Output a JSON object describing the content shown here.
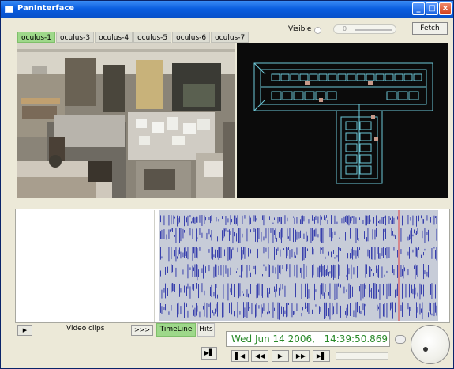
{
  "window": {
    "title": "PanInterface",
    "min": "_",
    "max": "□",
    "close": "x"
  },
  "camera_tabs": [
    "oculus-1",
    "oculus-3",
    "oculus-4",
    "oculus-5",
    "oculus-6",
    "oculus-7"
  ],
  "active_tab": "oculus-1",
  "visible": {
    "label": "Visible",
    "slider_value": "0"
  },
  "fetch_label": "Fetch",
  "clips": {
    "play": "▶",
    "label": "Video clips",
    "more": ">>>"
  },
  "bottom_tabs": {
    "timeline": "TimeLine",
    "hits": "Hits"
  },
  "datetime": {
    "date": "Wed Jun 14 2006,",
    "time": "14:39:50.869"
  },
  "controls": {
    "jump": "▶▌",
    "first": "▌◀",
    "rewind": "◀◀",
    "play": "▶",
    "forward": "▶▶",
    "last": "▶▌"
  },
  "colors": {
    "tab_active": "#9ed88a",
    "map_lines": "#6ec8d8",
    "timeline_marks": "#2a32a8",
    "cursor": "#e04040",
    "date_text": "#2a8a2a"
  }
}
